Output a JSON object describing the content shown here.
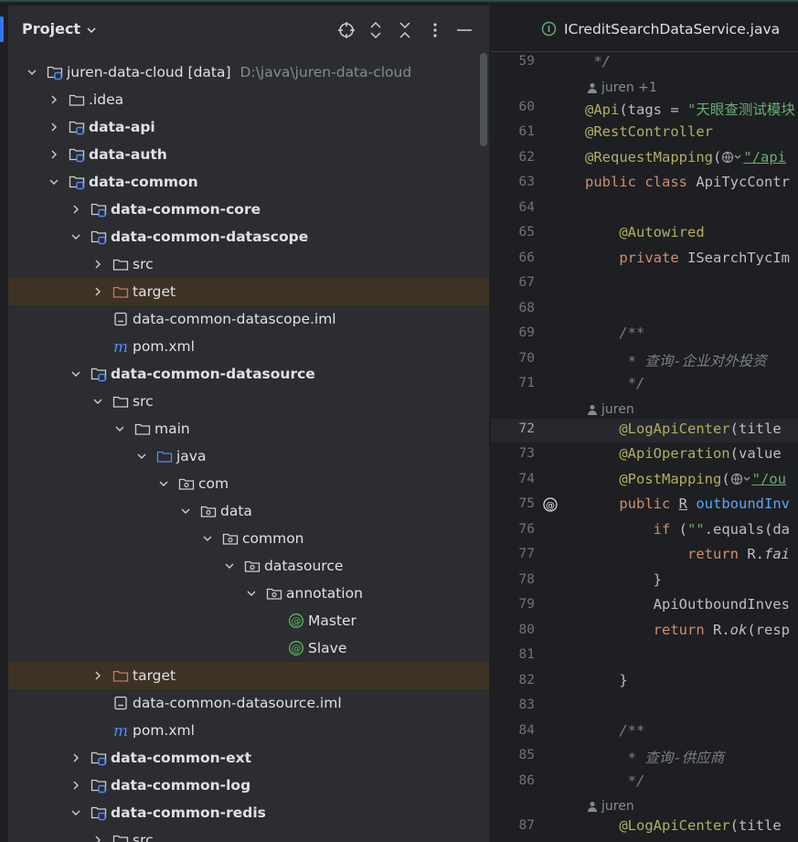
{
  "project_panel": {
    "title": "Project",
    "header_buttons": [
      "locate-icon",
      "expand-all-icon",
      "collapse-all-icon",
      "more-icon",
      "minimize-icon"
    ],
    "rows": [
      {
        "depth": 0,
        "chev": "down",
        "icon": "module-folder",
        "label": "juren-data-cloud [data]",
        "path": "D:\\java\\juren-data-cloud",
        "bold": false,
        "hl": false
      },
      {
        "depth": 1,
        "chev": "right",
        "icon": "folder",
        "label": ".idea",
        "bold": false,
        "hl": false
      },
      {
        "depth": 1,
        "chev": "right",
        "icon": "module-folder",
        "label": "data-api",
        "bold": true,
        "hl": false
      },
      {
        "depth": 1,
        "chev": "right",
        "icon": "module-folder",
        "label": "data-auth",
        "bold": true,
        "hl": false
      },
      {
        "depth": 1,
        "chev": "down",
        "icon": "module-folder",
        "label": "data-common",
        "bold": true,
        "hl": false
      },
      {
        "depth": 2,
        "chev": "right",
        "icon": "module-folder",
        "label": "data-common-core",
        "bold": true,
        "hl": false
      },
      {
        "depth": 2,
        "chev": "down",
        "icon": "module-folder",
        "label": "data-common-datascope",
        "bold": true,
        "hl": false
      },
      {
        "depth": 3,
        "chev": "right",
        "icon": "folder",
        "label": "src",
        "bold": false,
        "hl": false
      },
      {
        "depth": 3,
        "chev": "right",
        "icon": "excluded-folder",
        "label": "target",
        "bold": false,
        "hl": true
      },
      {
        "depth": 3,
        "chev": "",
        "icon": "iml-file",
        "label": "data-common-datascope.iml",
        "bold": false,
        "hl": false
      },
      {
        "depth": 3,
        "chev": "",
        "icon": "maven-file",
        "label": "pom.xml",
        "bold": false,
        "hl": false
      },
      {
        "depth": 2,
        "chev": "down",
        "icon": "module-folder",
        "label": "data-common-datasource",
        "bold": true,
        "hl": false
      },
      {
        "depth": 3,
        "chev": "down",
        "icon": "folder",
        "label": "src",
        "bold": false,
        "hl": false
      },
      {
        "depth": 4,
        "chev": "down",
        "icon": "folder",
        "label": "main",
        "bold": false,
        "hl": false
      },
      {
        "depth": 5,
        "chev": "down",
        "icon": "source-folder",
        "label": "java",
        "bold": false,
        "hl": false
      },
      {
        "depth": 6,
        "chev": "down",
        "icon": "package-folder",
        "label": "com",
        "bold": false,
        "hl": false
      },
      {
        "depth": 7,
        "chev": "down",
        "icon": "package-folder",
        "label": "data",
        "bold": false,
        "hl": false
      },
      {
        "depth": 8,
        "chev": "down",
        "icon": "package-folder",
        "label": "common",
        "bold": false,
        "hl": false
      },
      {
        "depth": 9,
        "chev": "down",
        "icon": "package-folder",
        "label": "datasource",
        "bold": false,
        "hl": false
      },
      {
        "depth": 10,
        "chev": "down",
        "icon": "package-folder",
        "label": "annotation",
        "bold": false,
        "hl": false
      },
      {
        "depth": 11,
        "chev": "",
        "icon": "annotation-file",
        "label": "Master",
        "bold": false,
        "hl": false
      },
      {
        "depth": 11,
        "chev": "",
        "icon": "annotation-file",
        "label": "Slave",
        "bold": false,
        "hl": false
      },
      {
        "depth": 3,
        "chev": "right",
        "icon": "excluded-folder",
        "label": "target",
        "bold": false,
        "hl": true
      },
      {
        "depth": 3,
        "chev": "",
        "icon": "iml-file",
        "label": "data-common-datasource.iml",
        "bold": false,
        "hl": false
      },
      {
        "depth": 3,
        "chev": "",
        "icon": "maven-file",
        "label": "pom.xml",
        "bold": false,
        "hl": false
      },
      {
        "depth": 2,
        "chev": "right",
        "icon": "module-folder",
        "label": "data-common-ext",
        "bold": true,
        "hl": false
      },
      {
        "depth": 2,
        "chev": "right",
        "icon": "module-folder",
        "label": "data-common-log",
        "bold": true,
        "hl": false
      },
      {
        "depth": 2,
        "chev": "down",
        "icon": "module-folder",
        "label": "data-common-redis",
        "bold": true,
        "hl": false
      },
      {
        "depth": 3,
        "chev": "right",
        "icon": "folder",
        "label": "src",
        "bold": false,
        "hl": false
      }
    ]
  },
  "editor": {
    "tab": {
      "label": "ICreditSearchDataService.java",
      "icon": "interface-icon"
    },
    "lines": [
      {
        "kind": "code",
        "ln": "59",
        "parts": [
          {
            "t": " */",
            "c": "cm"
          }
        ]
      },
      {
        "kind": "author",
        "text": "juren +1"
      },
      {
        "kind": "code",
        "ln": "60",
        "parts": [
          {
            "t": "@Api",
            "c": "ann"
          },
          {
            "t": "(tags = ",
            "c": ""
          },
          {
            "t": "\"天眼查测试模块",
            "c": "str"
          }
        ]
      },
      {
        "kind": "code",
        "ln": "61",
        "parts": [
          {
            "t": "@RestController",
            "c": "ann"
          }
        ]
      },
      {
        "kind": "code",
        "ln": "62",
        "parts": [
          {
            "t": "@RequestMapping",
            "c": "ann"
          },
          {
            "t": "(",
            "c": ""
          },
          {
            "t": "@globe",
            "c": "globe"
          },
          {
            "t": "\"/api",
            "c": "str link"
          }
        ]
      },
      {
        "kind": "code",
        "ln": "63",
        "parts": [
          {
            "t": "public class ",
            "c": "kw"
          },
          {
            "t": "ApiTycContr",
            "c": ""
          }
        ]
      },
      {
        "kind": "code",
        "ln": "64",
        "parts": []
      },
      {
        "kind": "code",
        "ln": "65",
        "parts": [
          {
            "t": "    ",
            "c": ""
          },
          {
            "t": "@Autowired",
            "c": "ann"
          }
        ]
      },
      {
        "kind": "code",
        "ln": "66",
        "parts": [
          {
            "t": "    ",
            "c": ""
          },
          {
            "t": "private ",
            "c": "kw"
          },
          {
            "t": "ISearchTycIm",
            "c": ""
          }
        ]
      },
      {
        "kind": "code",
        "ln": "67",
        "parts": []
      },
      {
        "kind": "code",
        "ln": "68",
        "parts": []
      },
      {
        "kind": "code",
        "ln": "69",
        "parts": [
          {
            "t": "    /**",
            "c": "cm"
          }
        ]
      },
      {
        "kind": "code",
        "ln": "70",
        "parts": [
          {
            "t": "     * 查询-企业对外投资",
            "c": "cm"
          }
        ]
      },
      {
        "kind": "code",
        "ln": "71",
        "parts": [
          {
            "t": "     */",
            "c": "cm"
          }
        ]
      },
      {
        "kind": "author",
        "text": "juren"
      },
      {
        "kind": "code",
        "ln": "72",
        "cur": true,
        "parts": [
          {
            "t": "    ",
            "c": ""
          },
          {
            "t": "@LogApiCenter",
            "c": "ann"
          },
          {
            "t": "(title",
            "c": ""
          }
        ]
      },
      {
        "kind": "code",
        "ln": "73",
        "parts": [
          {
            "t": "    ",
            "c": ""
          },
          {
            "t": "@ApiOperation",
            "c": "ann"
          },
          {
            "t": "(value",
            "c": ""
          }
        ]
      },
      {
        "kind": "code",
        "ln": "74",
        "parts": [
          {
            "t": "    ",
            "c": ""
          },
          {
            "t": "@PostMapping",
            "c": "ann"
          },
          {
            "t": "(",
            "c": ""
          },
          {
            "t": "@globe",
            "c": "globe"
          },
          {
            "t": "\"/ou",
            "c": "str link"
          }
        ]
      },
      {
        "kind": "code",
        "ln": "75",
        "mark": "@",
        "parts": [
          {
            "t": "    ",
            "c": ""
          },
          {
            "t": "public ",
            "c": "kw"
          },
          {
            "t": "R",
            "c": "link"
          },
          {
            "t": " ",
            "c": ""
          },
          {
            "t": "outboundInv",
            "c": "fn"
          }
        ]
      },
      {
        "kind": "code",
        "ln": "76",
        "parts": [
          {
            "t": "        ",
            "c": ""
          },
          {
            "t": "if ",
            "c": "kw"
          },
          {
            "t": "(",
            "c": ""
          },
          {
            "t": "\"\"",
            "c": "str"
          },
          {
            "t": ".equals(da",
            "c": ""
          }
        ]
      },
      {
        "kind": "code",
        "ln": "77",
        "parts": [
          {
            "t": "            ",
            "c": ""
          },
          {
            "t": "return ",
            "c": "kw"
          },
          {
            "t": "R.",
            "c": ""
          },
          {
            "t": "fai",
            "c": "it"
          }
        ]
      },
      {
        "kind": "code",
        "ln": "78",
        "parts": [
          {
            "t": "        }",
            "c": ""
          }
        ]
      },
      {
        "kind": "code",
        "ln": "79",
        "parts": [
          {
            "t": "        ApiOutboundInves",
            "c": ""
          }
        ]
      },
      {
        "kind": "code",
        "ln": "80",
        "parts": [
          {
            "t": "        ",
            "c": ""
          },
          {
            "t": "return ",
            "c": "kw"
          },
          {
            "t": "R.",
            "c": ""
          },
          {
            "t": "ok",
            "c": "it"
          },
          {
            "t": "(resp",
            "c": ""
          }
        ]
      },
      {
        "kind": "code",
        "ln": "81",
        "parts": []
      },
      {
        "kind": "code",
        "ln": "82",
        "parts": [
          {
            "t": "    }",
            "c": ""
          }
        ]
      },
      {
        "kind": "code",
        "ln": "83",
        "parts": []
      },
      {
        "kind": "code",
        "ln": "84",
        "parts": [
          {
            "t": "    /**",
            "c": "cm"
          }
        ]
      },
      {
        "kind": "code",
        "ln": "85",
        "parts": [
          {
            "t": "     * 查询-供应商",
            "c": "cm"
          }
        ]
      },
      {
        "kind": "code",
        "ln": "86",
        "parts": [
          {
            "t": "     */",
            "c": "cm"
          }
        ]
      },
      {
        "kind": "author",
        "text": "juren"
      },
      {
        "kind": "code",
        "ln": "87",
        "parts": [
          {
            "t": "    ",
            "c": ""
          },
          {
            "t": "@LogApiCenter",
            "c": "ann"
          },
          {
            "t": "(title",
            "c": ""
          }
        ]
      }
    ]
  },
  "colors": {
    "accent": "#3574f0",
    "bg": "#1e1f22",
    "panel": "#2b2d30",
    "highlight": "#3d3223"
  }
}
